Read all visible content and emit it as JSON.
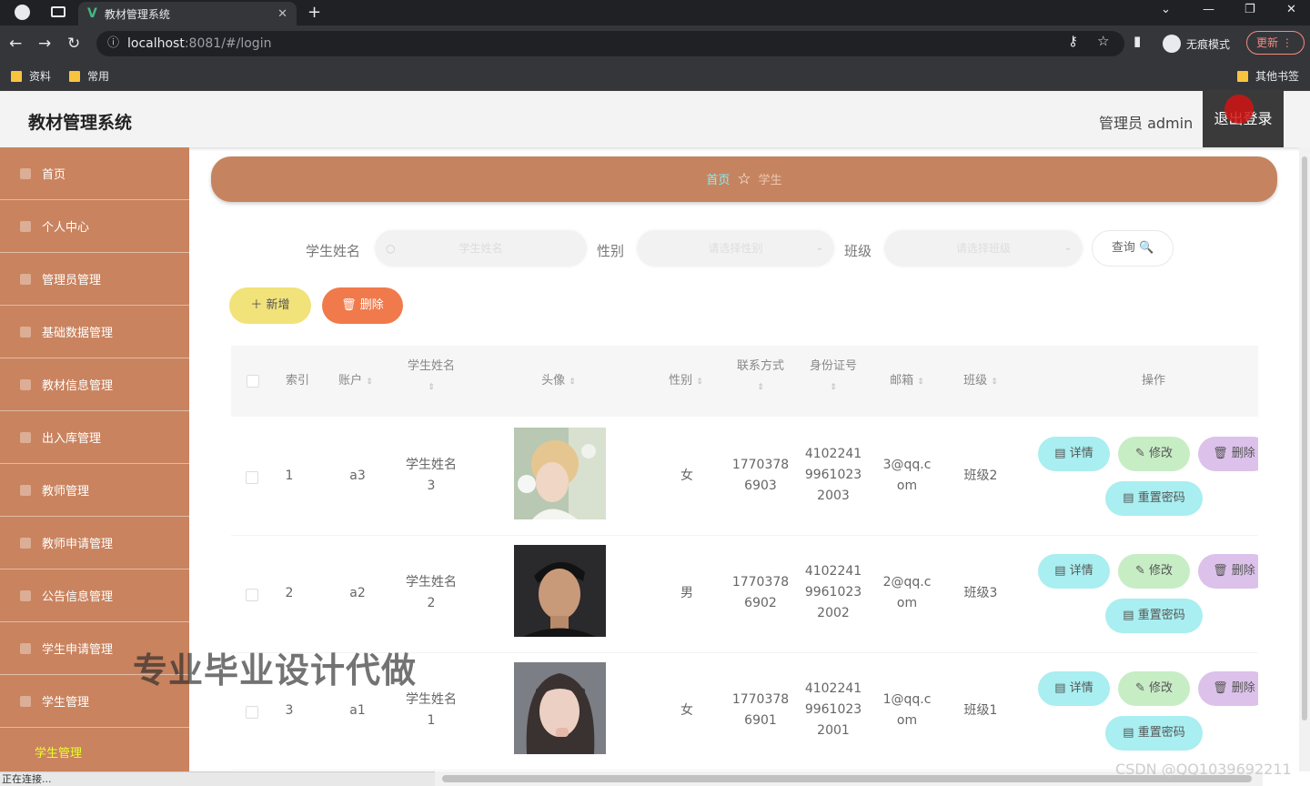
{
  "browser": {
    "tab_title": "教材管理系统",
    "tab_close": "✕",
    "new_tab": "+",
    "url_host": "localhost",
    "url_path": ":8081/#/login",
    "incognito_label": "无痕模式",
    "update_label": "更新 ⋮",
    "bookmarks": [
      "资料",
      "常用"
    ],
    "other_bookmarks": "其他书签",
    "status_text": "正在连接..."
  },
  "header": {
    "title": "教材管理系统",
    "admin": "管理员 admin",
    "logout": "退出登录"
  },
  "sidebar": {
    "items": [
      {
        "label": "首页"
      },
      {
        "label": "个人中心"
      },
      {
        "label": "管理员管理"
      },
      {
        "label": "基础数据管理"
      },
      {
        "label": "教材信息管理"
      },
      {
        "label": "出入库管理"
      },
      {
        "label": "教师管理"
      },
      {
        "label": "教师申请管理"
      },
      {
        "label": "公告信息管理"
      },
      {
        "label": "学生申请管理"
      },
      {
        "label": "学生管理"
      }
    ],
    "active_sub": "学生管理"
  },
  "breadcrumb": {
    "home": "首页",
    "current": "学生"
  },
  "search": {
    "name_label": "学生姓名",
    "name_placeholder": "学生姓名",
    "gender_label": "性别",
    "gender_placeholder": "请选择性别",
    "class_label": "班级",
    "class_placeholder": "请选择班级",
    "query_label": "查询 🔍"
  },
  "actions": {
    "add": "＋ 新增",
    "delete": "🗑 删除"
  },
  "table": {
    "headers": {
      "index": "索引",
      "account": "账户",
      "name": "学生姓名",
      "avatar": "头像",
      "gender": "性别",
      "phone": "联系方式",
      "idcard": "身份证号",
      "email": "邮箱",
      "class": "班级",
      "operation": "操作"
    },
    "rows": [
      {
        "index": "1",
        "account": "a3",
        "name": "学生姓名\n3",
        "gender": "女",
        "phone": "1770378\n6903",
        "idcard": "4102241\n9961023\n2003",
        "email": "3@qq.c\nom",
        "class": "班级2"
      },
      {
        "index": "2",
        "account": "a2",
        "name": "学生姓名\n2",
        "gender": "男",
        "phone": "1770378\n6902",
        "idcard": "4102241\n9961023\n2002",
        "email": "2@qq.c\nom",
        "class": "班级3"
      },
      {
        "index": "3",
        "account": "a1",
        "name": "学生姓名\n1",
        "gender": "女",
        "phone": "1770378\n6901",
        "idcard": "4102241\n9961023\n2001",
        "email": "1@qq.c\nom",
        "class": "班级1"
      }
    ],
    "row_actions": {
      "detail": "▤ 详情",
      "edit": "✎ 修改",
      "delete": "🗑 删除",
      "reset": "▤ 重置密码"
    }
  },
  "watermark": "专业毕业设计代做",
  "csdn": "CSDN @QQ1039692211"
}
